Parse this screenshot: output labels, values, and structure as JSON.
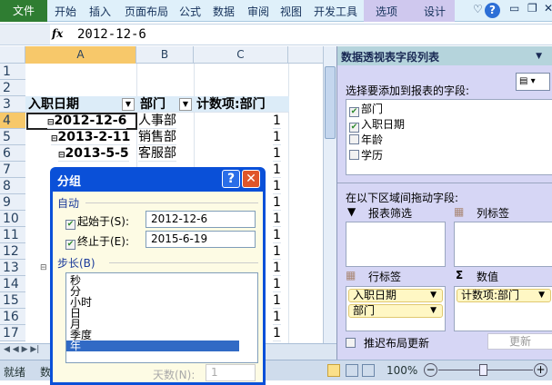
{
  "ribbon": {
    "tabs": [
      "文件",
      "开始",
      "插入",
      "页面布局",
      "公式",
      "数据",
      "审阅",
      "视图",
      "开发工具",
      "选项",
      "设计"
    ]
  },
  "formula": {
    "fx": "fx",
    "value": "2012-12-6"
  },
  "columns": [
    "A",
    "B",
    "C"
  ],
  "rows": [
    "1",
    "2",
    "3",
    "4",
    "5",
    "6",
    "7",
    "8",
    "9",
    "10",
    "11",
    "12",
    "13",
    "14",
    "15",
    "16",
    "17"
  ],
  "pivot": {
    "headers": [
      "入职日期",
      "部门",
      "计数项:部门"
    ],
    "rows": [
      {
        "date": "2012-12-6",
        "dept": "人事部",
        "count": "1"
      },
      {
        "date": "2013-2-11",
        "dept": "销售部",
        "count": "1"
      },
      {
        "date": "2013-5-5",
        "dept": "客服部",
        "count": "1"
      }
    ],
    "counts": [
      "1",
      "1",
      "1",
      "1",
      "1",
      "1",
      "1",
      "1",
      "1",
      "1",
      "1"
    ]
  },
  "status": {
    "ready": "就绪",
    "partial": "数",
    "zoom": "100%"
  },
  "pane": {
    "title": "数据透视表字段列表",
    "choose_label": "选择要添加到报表的字段:",
    "fields": [
      {
        "label": "部门",
        "checked": true
      },
      {
        "label": "入职日期",
        "checked": true
      },
      {
        "label": "年龄",
        "checked": false
      },
      {
        "label": "学历",
        "checked": false
      }
    ],
    "drag_label": "在以下区域间拖动字段:",
    "filter": "报表筛选",
    "columns": "列标签",
    "rows_label": "行标签",
    "values": "数值",
    "row_fields": [
      "入职日期",
      "部门"
    ],
    "value_fields": [
      "计数项:部门"
    ],
    "defer": "推迟布局更新",
    "update": "更新"
  },
  "dialog": {
    "title": "分组",
    "auto": "自动",
    "start_label": "起始于(S):",
    "start": "2012-12-6",
    "end_label": "终止于(E):",
    "end": "2015-6-19",
    "step": "步长(B)",
    "options": [
      "秒",
      "分",
      "小时",
      "日",
      "月",
      "季度",
      "年"
    ],
    "selected": "年",
    "days_label": "天数(N):",
    "days": "1"
  }
}
